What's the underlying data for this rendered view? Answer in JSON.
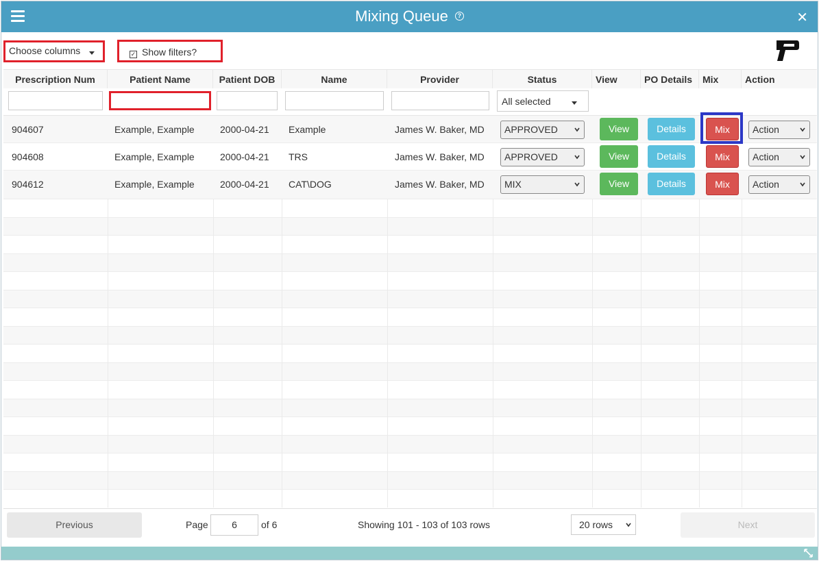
{
  "window": {
    "title": "Mixing Queue"
  },
  "toolbar": {
    "choose_columns": "Choose columns",
    "show_filters": "Show filters?"
  },
  "columns": [
    "Prescription Num",
    "Patient Name",
    "Patient DOB",
    "Name",
    "Provider",
    "Status",
    "View",
    "PO Details",
    "Mix",
    "Action"
  ],
  "filters": {
    "status_value": "All selected"
  },
  "rows": [
    {
      "rx": "904607",
      "patient": "Example, Example",
      "dob": "2000-04-21",
      "name": "Example",
      "provider": "James W. Baker, MD",
      "status": "APPROVED",
      "view": "View",
      "details": "Details",
      "mix": "Mix",
      "action": "Action"
    },
    {
      "rx": "904608",
      "patient": "Example, Example",
      "dob": "2000-04-21",
      "name": "TRS",
      "provider": "James W. Baker, MD",
      "status": "APPROVED",
      "view": "View",
      "details": "Details",
      "mix": "Mix",
      "action": "Action"
    },
    {
      "rx": "904612",
      "patient": "Example, Example",
      "dob": "2000-04-21",
      "name": "CAT\\DOG",
      "provider": "James W. Baker, MD",
      "status": "MIX",
      "view": "View",
      "details": "Details",
      "mix": "Mix",
      "action": "Action"
    }
  ],
  "pagination": {
    "previous": "Previous",
    "page_label": "Page",
    "page_value": "6",
    "of_label": "of 6",
    "showing": "Showing 101 - 103 of 103 rows",
    "rows_per_page": "20 rows",
    "next": "Next"
  },
  "colors": {
    "titlebar": "#4a9fc3",
    "highlight_red": "#e0212b",
    "highlight_blue": "#2c38c6",
    "view": "#5cb85c",
    "details": "#5bc0de",
    "mix": "#d9534f",
    "bottom_bar": "#94cccc"
  }
}
